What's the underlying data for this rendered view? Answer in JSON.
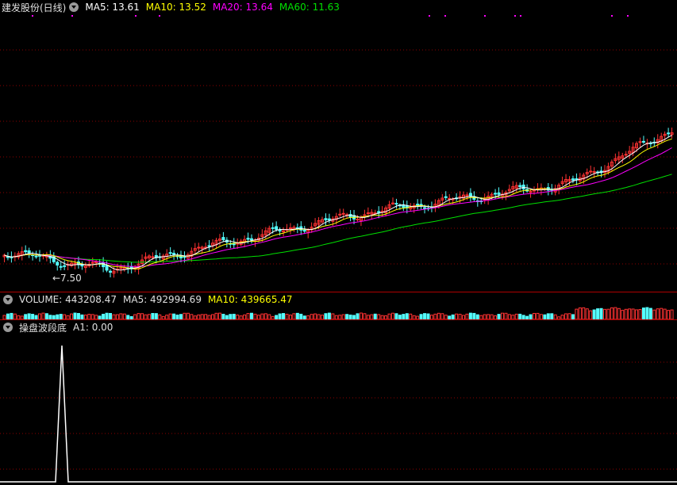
{
  "colors": {
    "up": "#ff3232",
    "down": "#54ffff",
    "ma5": "#ffffff",
    "ma10": "#ffff00",
    "ma20": "#ff00ff",
    "ma60": "#00e000",
    "grid": "#8b0000"
  },
  "price_panel": {
    "title": "建发股份(日线)",
    "ma5": "MA5: 13.61",
    "ma10": "MA10: 13.52",
    "ma20": "MA20: 13.64",
    "ma60": "MA60: 11.63",
    "low_marker": "←7.50"
  },
  "volume_panel": {
    "label": "VOLUME: 443208.47",
    "ma5": "MA5: 492994.69",
    "ma10": "MA10: 439665.47"
  },
  "indicator_panel": {
    "name": "操盘波段底",
    "a1": "A1: 0.00"
  },
  "icons": {
    "collapse": "chevron-down-icon"
  }
}
